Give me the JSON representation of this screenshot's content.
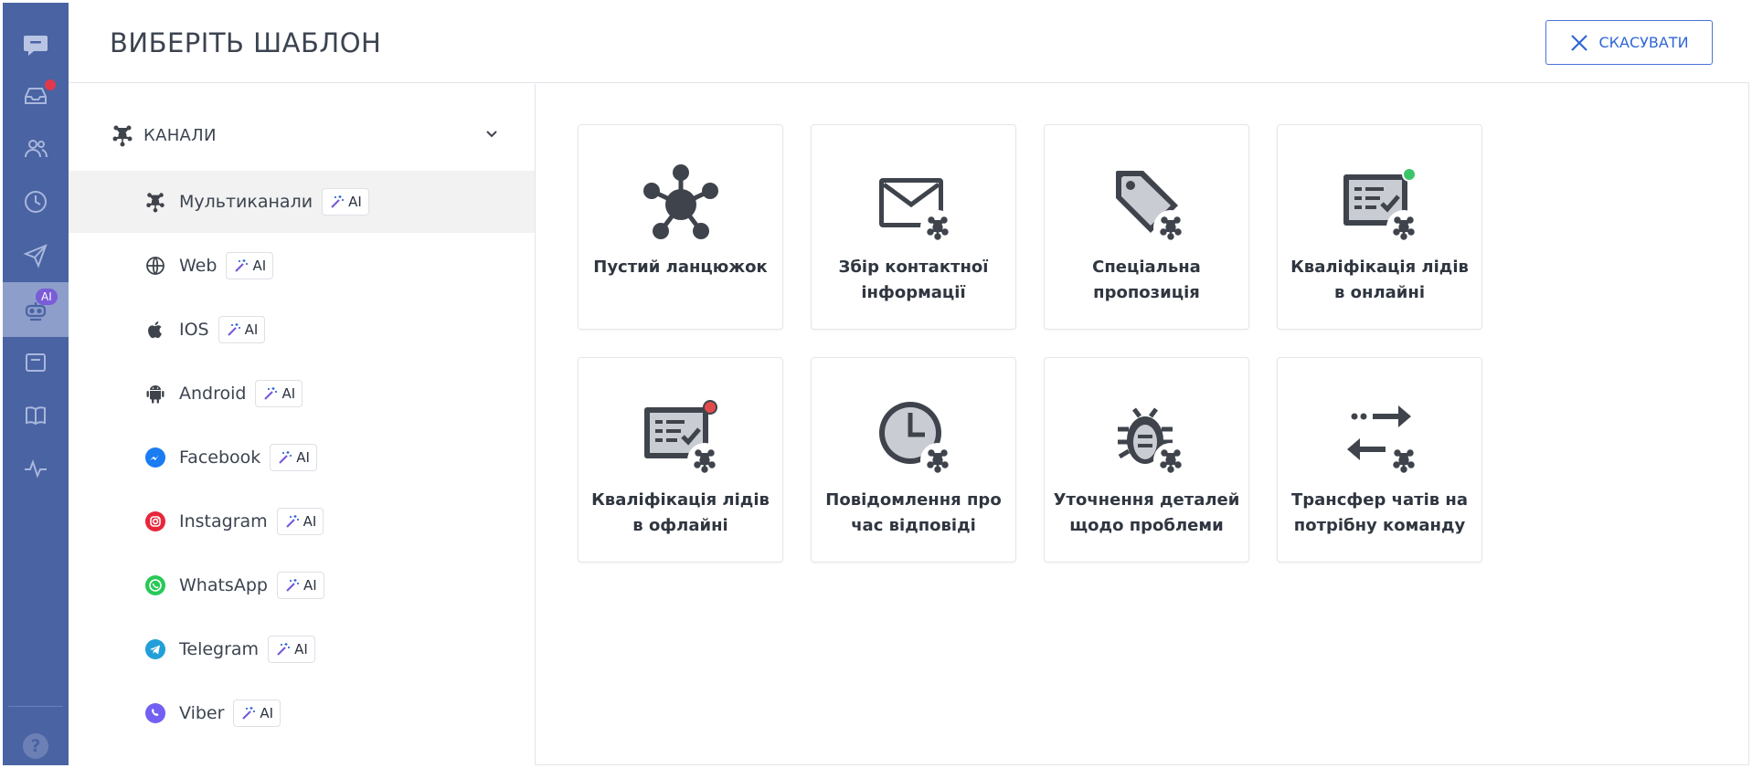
{
  "rail": {
    "items": [
      {
        "name": "logo-chat-icon"
      },
      {
        "name": "inbox-icon",
        "has_notification": true
      },
      {
        "name": "contacts-icon"
      },
      {
        "name": "history-clock-icon"
      },
      {
        "name": "send-campaign-icon"
      },
      {
        "name": "bot-icon",
        "active": true,
        "badge": "AI"
      },
      {
        "name": "widget-icon"
      },
      {
        "name": "knowledge-book-icon"
      },
      {
        "name": "analytics-pulse-icon"
      }
    ],
    "help_label": "?"
  },
  "header": {
    "title": "ВИБЕРІТЬ ШАБЛОН",
    "cancel_label": "СКАСУВАТИ"
  },
  "sidebar": {
    "group_label": "КАНАЛИ",
    "ai_label": "AI",
    "items": [
      {
        "label": "Мультиканали",
        "icon": "multichannel-icon",
        "active": true
      },
      {
        "label": "Web",
        "icon": "globe-icon"
      },
      {
        "label": "IOS",
        "icon": "apple-icon"
      },
      {
        "label": "Android",
        "icon": "android-icon"
      },
      {
        "label": "Facebook",
        "icon": "messenger-icon"
      },
      {
        "label": "Instagram",
        "icon": "instagram-icon"
      },
      {
        "label": "WhatsApp",
        "icon": "whatsapp-icon"
      },
      {
        "label": "Telegram",
        "icon": "telegram-icon"
      },
      {
        "label": "Viber",
        "icon": "viber-icon"
      }
    ]
  },
  "templates": [
    {
      "label": "Пустий ланцюжок",
      "icon": "network-hub-icon"
    },
    {
      "label": "Збір контактної інформації",
      "icon": "envelope-icon"
    },
    {
      "label": "Спеціальна пропозиція",
      "icon": "price-tag-icon"
    },
    {
      "label": "Кваліфікація лідів в онлайні",
      "icon": "checklist-online-icon"
    },
    {
      "label": "Кваліфікація лідів в офлайні",
      "icon": "checklist-offline-icon"
    },
    {
      "label": "Повідомлення про час відповіді",
      "icon": "clock-icon"
    },
    {
      "label": "Уточнення деталей щодо проблеми",
      "icon": "bug-icon"
    },
    {
      "label": "Трансфер чатів на потрібну команду",
      "icon": "transfer-arrows-icon"
    }
  ],
  "colors": {
    "rail": "#4a63a3",
    "rail_active": "#8d9eca",
    "accent": "#3166d6",
    "icon_dark": "#3f444c",
    "online_dot": "#3cc46a",
    "offline_dot": "#e24b4b",
    "ai_purple": "#7a5bd8"
  }
}
